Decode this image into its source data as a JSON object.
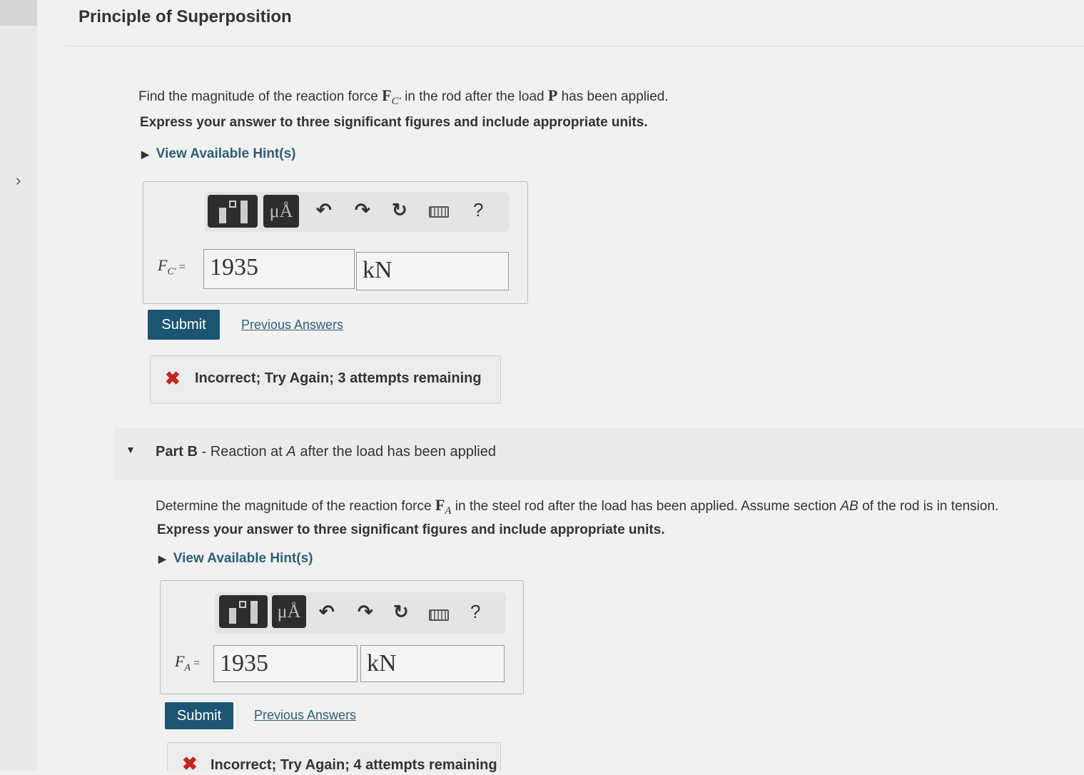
{
  "page": {
    "title": "Principle of Superposition",
    "expand_icon": "chevron-right-icon"
  },
  "part_a": {
    "question_pre": "Find the magnitude of the reaction force ",
    "force_symbol": "F",
    "force_sub": "C′",
    "question_mid": " in the rod after the load ",
    "load_symbol": "P",
    "question_post": " has been applied.",
    "express": "Express your answer to three significant figures and include appropriate units.",
    "hint_label": "View Available Hint(s)",
    "toolbar": {
      "units_label": "μÅ",
      "help_label": "?"
    },
    "variable_symbol": "F",
    "variable_sub": "C′",
    "equals": "=",
    "value": "1935",
    "units": "kN",
    "submit_label": "Submit",
    "previous_answers_label": "Previous Answers",
    "feedback": "Incorrect; Try Again; 3 attempts remaining"
  },
  "part_b": {
    "label": "Part B",
    "heading_sep": " - ",
    "heading_pre": "Reaction at ",
    "heading_var": "A",
    "heading_post": " after the load has been applied",
    "question_pre": "Determine the magnitude of the reaction force ",
    "force_symbol": "F",
    "force_sub": "A",
    "question_mid": " in the steel rod after the load has been applied. Assume section ",
    "section_var": "AB",
    "question_post": " of the rod is in tension.",
    "express": "Express your answer to three significant figures and include appropriate units.",
    "hint_label": "View Available Hint(s)",
    "toolbar": {
      "units_label": "μÅ",
      "help_label": "?"
    },
    "variable_symbol": "F",
    "variable_sub": "A",
    "equals": "=",
    "value": "1935",
    "units": "kN",
    "submit_label": "Submit",
    "previous_answers_label": "Previous Answers",
    "feedback": "Incorrect; Try Again; 4 attempts remaining"
  },
  "colors": {
    "submit_bg": "#1c5572",
    "link": "#2d5f78",
    "error_x": "#c2271f"
  }
}
